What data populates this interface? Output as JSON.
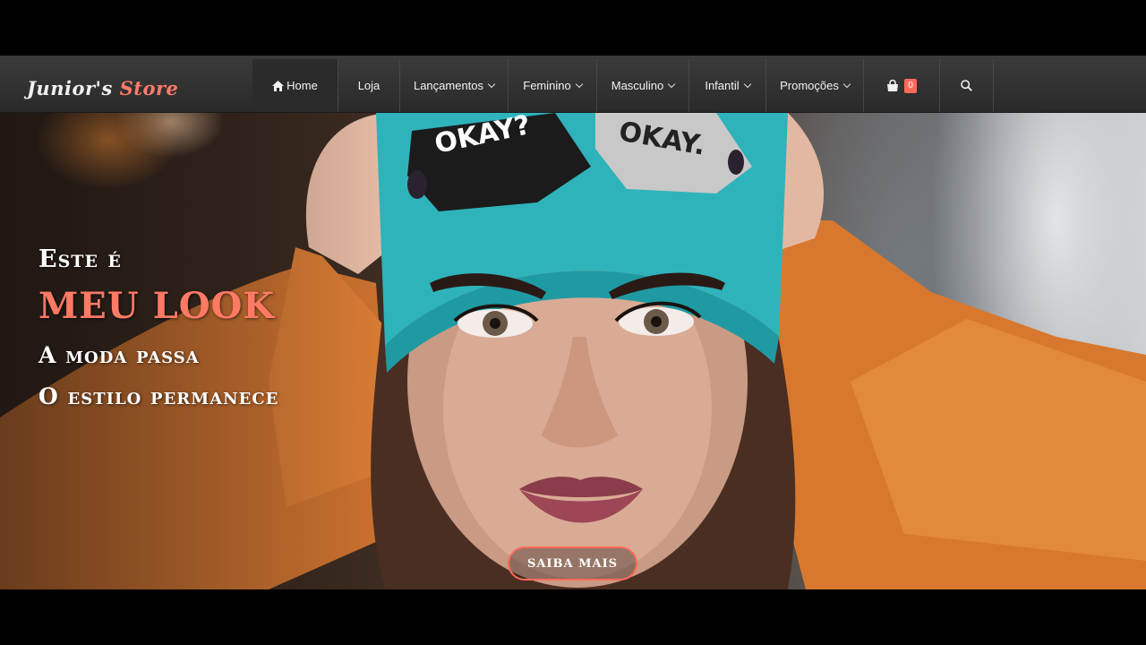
{
  "brand": {
    "name_part1": "Junior's",
    "name_part2": "Store"
  },
  "nav": {
    "items": [
      {
        "label": "Home",
        "icon": "home-icon",
        "active": true
      },
      {
        "label": "Loja"
      },
      {
        "label": "Lançamentos",
        "dropdown": true
      },
      {
        "label": "Feminino",
        "dropdown": true
      },
      {
        "label": "Masculino",
        "dropdown": true
      },
      {
        "label": "Infantil",
        "dropdown": true
      },
      {
        "label": "Promoções",
        "dropdown": true
      }
    ],
    "cart": {
      "icon": "shopping-bag-icon",
      "count": "0"
    },
    "search": {
      "icon": "search-icon"
    }
  },
  "hero": {
    "line1": "Este é",
    "line2": "MEU LOOK",
    "line3": "A moda passa",
    "line4": "O estilo permanece",
    "cta_label": "SAIBA MAIS",
    "hat_texts": [
      "OKAY?",
      "OKAY."
    ]
  },
  "colors": {
    "accent": "#ff6b5b",
    "navbar": "#333333",
    "hat": "#2fb3bb",
    "sweater": "#d9782f"
  }
}
